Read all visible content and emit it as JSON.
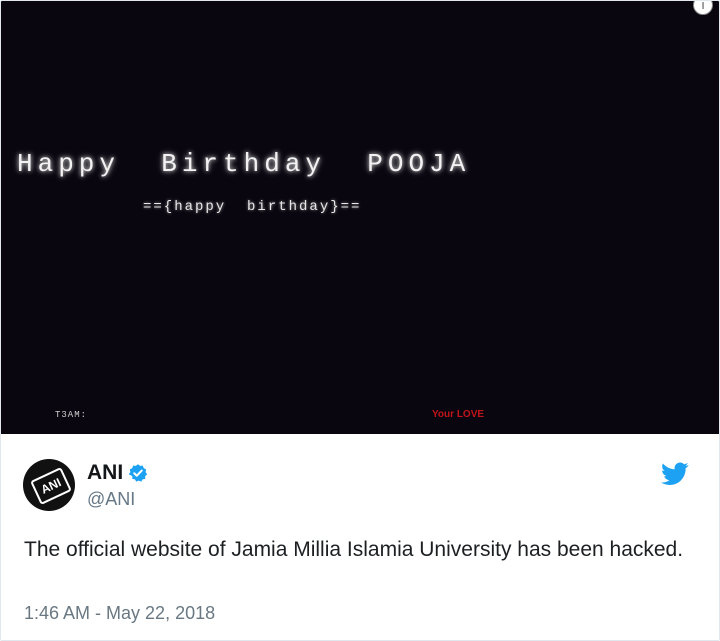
{
  "media": {
    "title": "Happy  Birthday  POOJA",
    "subtitle": "=={happy  birthday}==",
    "team_label": "T3AM:",
    "love_label": "Your LOVE"
  },
  "tweet": {
    "display_name": "ANI",
    "handle": "@ANI",
    "avatar_text": "ANI",
    "text": "The official website of Jamia Millia Islamia University has been hacked.",
    "timestamp": "1:46 AM - May 22, 2018"
  },
  "icons": {
    "verified": "verified-badge-icon",
    "twitter": "twitter-bird-icon",
    "media_corner": "info-icon"
  },
  "colors": {
    "twitter_blue": "#1da1f2",
    "love_red": "#c0141a",
    "media_bg": "#09060f"
  }
}
